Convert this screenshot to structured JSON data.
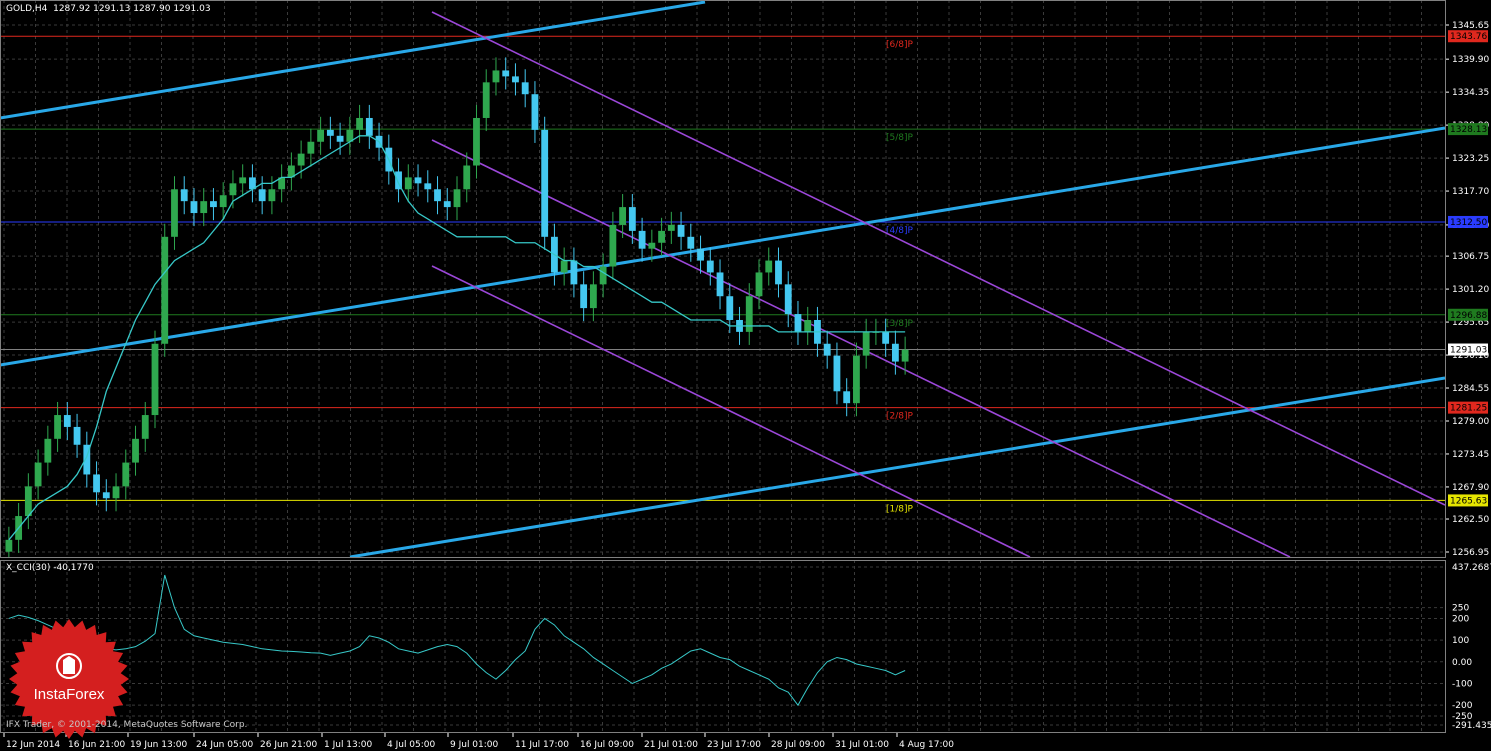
{
  "header": {
    "symbol": "GOLD,H4",
    "ohlc": "1287.92 1291.13 1287.90 1291.03"
  },
  "indicator": {
    "title": "X_CCI(30) -40,1770"
  },
  "footer": {
    "copyright": "IFX Trader, © 2001-2014, MetaQuotes Software Corp."
  },
  "logo": {
    "text": "InstaForex",
    "color": "#d41f1f"
  },
  "chart_data": [
    {
      "type": "candlestick",
      "y_ticks": [
        "1345.65",
        "1339.90",
        "1334.35",
        "1328.80",
        "1323.25",
        "1317.70",
        "1312.00",
        "1306.75",
        "1301.20",
        "1295.65",
        "1290.10",
        "1284.55",
        "1279.00",
        "1273.45",
        "1267.90",
        "1262.50",
        "1256.95"
      ],
      "ylim": [
        1256.95,
        1345.65
      ],
      "x_ticks": [
        "12 Jun 2014",
        "16 Jun 21:00",
        "19 Jun 13:00",
        "24 Jun 05:00",
        "26 Jun 21:00",
        "1 Jul 13:00",
        "4 Jul 05:00",
        "9 Jul 01:00",
        "11 Jul 17:00",
        "16 Jul 09:00",
        "21 Jul 01:00",
        "23 Jul 17:00",
        "28 Jul 09:00",
        "31 Jul 01:00",
        "4 Aug 17:00"
      ],
      "current_price": "1291.03",
      "murrey_levels": [
        {
          "price": 1343.76,
          "label": "[6/8]P",
          "price_label": "1343.76",
          "color": "#e0281e"
        },
        {
          "price": 1328.13,
          "label": "[5/8]P",
          "price_label": "1328.13",
          "color": "#1f7a1f"
        },
        {
          "price": 1312.5,
          "label": "[4/8]P",
          "price_label": "1312.50",
          "color": "#2a3cff"
        },
        {
          "price": 1296.88,
          "label": "[3/8]P",
          "price_label": "1296.88",
          "color": "#1f7a1f"
        },
        {
          "price": 1281.25,
          "label": "[2/8]P",
          "price_label": "1281.25",
          "color": "#e0281e"
        },
        {
          "price": 1265.63,
          "label": "[1/8]P",
          "price_label": "1265.63",
          "color": "#e6e600"
        }
      ],
      "closes": [
        1259,
        1263,
        1268,
        1272,
        1276,
        1280,
        1278,
        1275,
        1270,
        1267,
        1266,
        1268,
        1272,
        1276,
        1280,
        1292,
        1310,
        1318,
        1316,
        1314,
        1316,
        1315,
        1317,
        1319,
        1320,
        1318,
        1316,
        1318,
        1320,
        1322,
        1324,
        1326,
        1328,
        1327,
        1326,
        1328,
        1330,
        1327,
        1325,
        1321,
        1318,
        1320,
        1319,
        1318,
        1316,
        1315,
        1318,
        1322,
        1330,
        1336,
        1338,
        1337,
        1336,
        1334,
        1328,
        1310,
        1304,
        1306,
        1302,
        1298,
        1302,
        1305,
        1312,
        1315,
        1311,
        1308,
        1309,
        1311,
        1312,
        1310,
        1308,
        1306,
        1304,
        1300,
        1296,
        1294,
        1300,
        1304,
        1306,
        1302,
        1297,
        1294,
        1296,
        1292,
        1290,
        1284,
        1282,
        1290,
        1294,
        1294,
        1292,
        1289,
        1291
      ],
      "ma": [
        1259,
        1261,
        1263,
        1265,
        1266,
        1267,
        1268,
        1270,
        1273,
        1278,
        1284,
        1288,
        1292,
        1296,
        1299,
        1302,
        1304,
        1306,
        1307,
        1308,
        1309,
        1311,
        1313,
        1316,
        1317,
        1318,
        1319,
        1319,
        1320,
        1320,
        1321,
        1322,
        1323,
        1324,
        1325,
        1326,
        1327,
        1327,
        1326,
        1323,
        1319,
        1316,
        1314,
        1313,
        1312,
        1311,
        1310,
        1310,
        1310,
        1310,
        1310,
        1310,
        1309,
        1309,
        1309,
        1308,
        1307,
        1306,
        1306,
        1305,
        1305,
        1304,
        1303,
        1302,
        1301,
        1300,
        1299,
        1299,
        1298,
        1297,
        1296,
        1296,
        1296,
        1296,
        1295,
        1295,
        1295,
        1295,
        1295,
        1294,
        1294,
        1294,
        1294,
        1294,
        1294,
        1294,
        1294,
        1294,
        1294,
        1294,
        1294,
        1294,
        1294
      ],
      "colors": {
        "bull": "#2fa84f",
        "bear": "#44c8f0",
        "ma": "#37c8c8",
        "channel_cyan": "#29a8e8",
        "channel_violet": "#9b47d8",
        "grid": "#3a3a3a",
        "axis_text": "#ffffff"
      }
    },
    {
      "type": "line",
      "series_label": "X_CCI(30)",
      "y_ticks": [
        "437.2687",
        "250",
        "200",
        "100",
        "0.00",
        "-100",
        "-200",
        "-250",
        "-291.4354"
      ],
      "ylim": [
        -291.4354,
        437.2687
      ],
      "values": [
        200,
        215,
        205,
        190,
        170,
        150,
        130,
        110,
        90,
        70,
        60,
        55,
        60,
        70,
        95,
        130,
        400,
        250,
        150,
        120,
        110,
        100,
        90,
        85,
        80,
        70,
        60,
        55,
        50,
        48,
        45,
        42,
        40,
        30,
        40,
        50,
        70,
        120,
        110,
        90,
        60,
        50,
        40,
        55,
        70,
        80,
        70,
        40,
        -10,
        -50,
        -80,
        -40,
        10,
        50,
        150,
        200,
        170,
        120,
        90,
        60,
        20,
        -10,
        -40,
        -70,
        -100,
        -80,
        -60,
        -30,
        -10,
        20,
        50,
        60,
        40,
        20,
        10,
        -20,
        -40,
        -60,
        -80,
        -120,
        -140,
        -200,
        -120,
        -50,
        0,
        20,
        10,
        -10,
        -20,
        -30,
        -40,
        -60,
        -40
      ]
    }
  ]
}
